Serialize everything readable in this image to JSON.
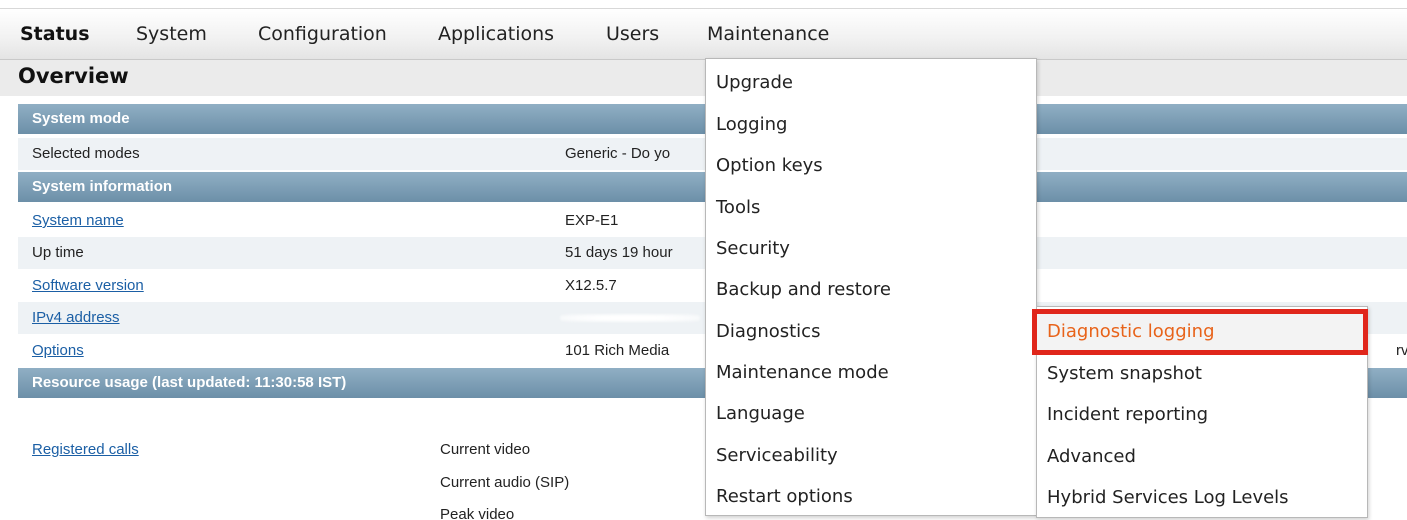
{
  "nav": {
    "items": [
      "Status",
      "System",
      "Configuration",
      "Applications",
      "Users",
      "Maintenance"
    ]
  },
  "overview": {
    "title": "Overview"
  },
  "sections": {
    "system_mode": "System mode",
    "system_information": "System information",
    "resource_usage": "Resource usage (last updated: 11:30:58 IST)"
  },
  "rows": {
    "selected_modes": {
      "label": "Selected modes",
      "value": "Generic - Do yo"
    },
    "system_name": {
      "label": "System name",
      "value": "EXP-E1"
    },
    "up_time": {
      "label": "Up time",
      "value": "51 days 19 hour"
    },
    "software_version": {
      "label": "Software version",
      "value": "X12.5.7"
    },
    "ipv4_address": {
      "label": "IPv4 address",
      "value": ""
    },
    "options": {
      "label": "Options",
      "value": "101 Rich Media",
      "trail": "rve"
    },
    "registered_calls": {
      "label": "Registered calls",
      "metrics": [
        "Current video",
        "Current audio (SIP)",
        "Peak video"
      ]
    }
  },
  "maintenance_menu": {
    "items": [
      "Upgrade",
      "Logging",
      "Option keys",
      "Tools",
      "Security",
      "Backup and restore",
      "Diagnostics",
      "Maintenance mode",
      "Language",
      "Serviceability",
      "Restart options"
    ]
  },
  "diagnostics_menu": {
    "items": [
      "Diagnostic logging",
      "System snapshot",
      "Incident reporting",
      "Advanced",
      "Hybrid Services Log Levels"
    ],
    "highlighted": "Diagnostic logging"
  },
  "colors": {
    "section_header": "#7a9bb2",
    "link": "#1b5fa5",
    "highlight_text": "#e8631a",
    "annotation_box": "#e0261b"
  }
}
